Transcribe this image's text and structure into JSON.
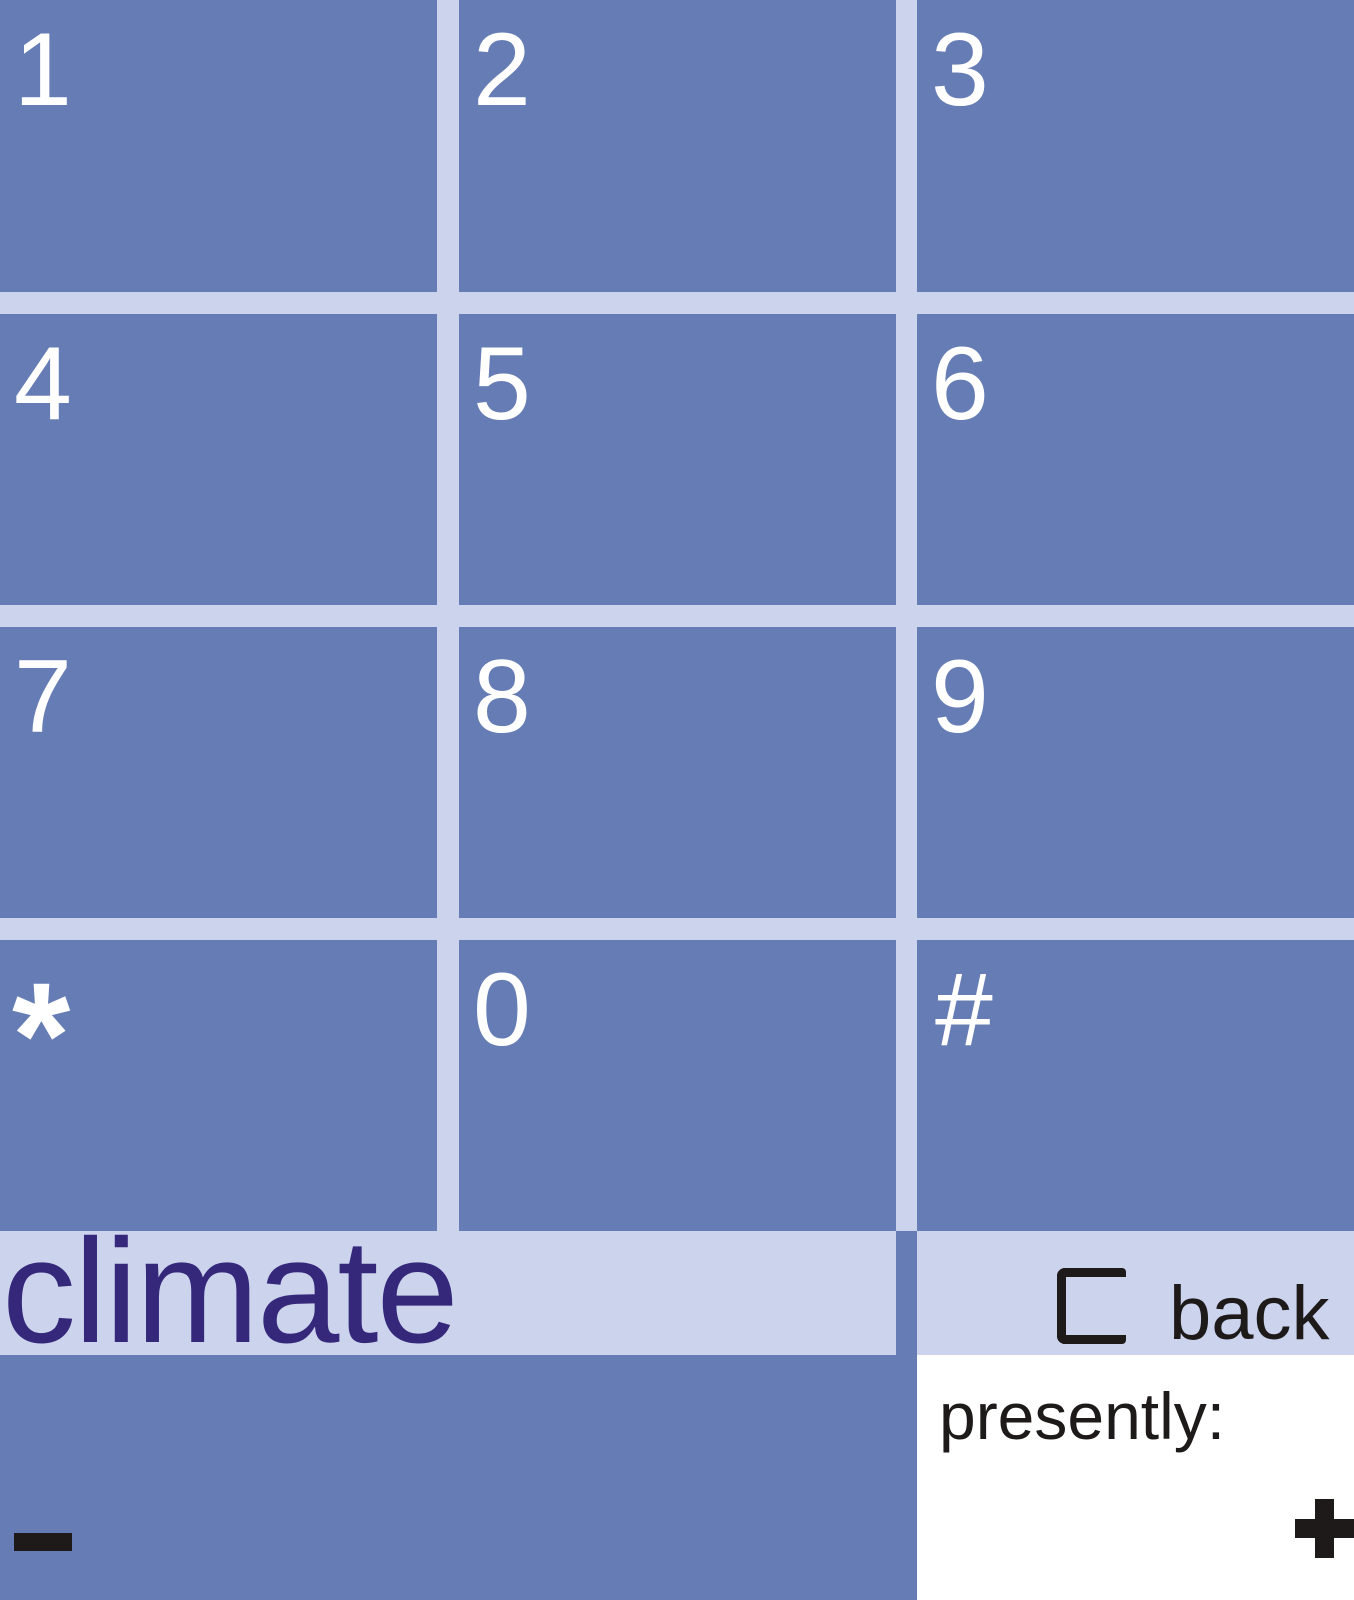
{
  "keypad": {
    "keys": [
      "1",
      "2",
      "3",
      "4",
      "5",
      "6",
      "7",
      "8",
      "9",
      "*",
      "0",
      "#"
    ]
  },
  "mode": {
    "label": "climate"
  },
  "back": {
    "label": "back"
  },
  "status": {
    "label": "presently:"
  },
  "colors": {
    "key_fill": "#667cb4",
    "gap": "#cbd3ed",
    "key_text": "#ffffff",
    "mode_text": "#35287a",
    "control_glyphs": "#1e1a1a"
  },
  "icons": {
    "back": "clear-c-icon",
    "decrease": "minus-icon",
    "increase": "plus-icon"
  }
}
